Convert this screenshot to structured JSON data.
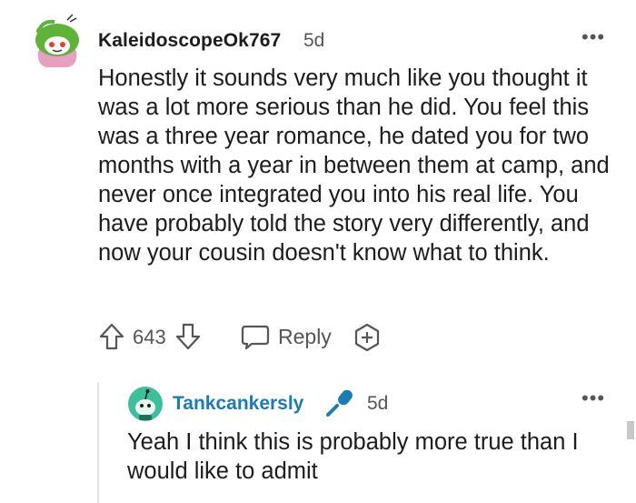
{
  "comment": {
    "username": "KaleidoscopeOk767",
    "age": "5d",
    "more_label": "•••",
    "body": "Honestly it sounds very much like you thought it was a lot more serious than he did. You feel this was a three year romance, he dated you for two months with a year in between them at camp, and never once integrated you into his real life. You have probably told the story very differently, and now your cousin doesn't know what to think.",
    "vote_count": "643",
    "reply_label": "Reply"
  },
  "reply": {
    "username": "Tankcankersly",
    "age": "5d",
    "more_label": "•••",
    "body": "Yeah I think this is probably more true than I would like to admit",
    "author_badge_icon": "microphone-icon",
    "author_color": "#1b7bb3"
  }
}
